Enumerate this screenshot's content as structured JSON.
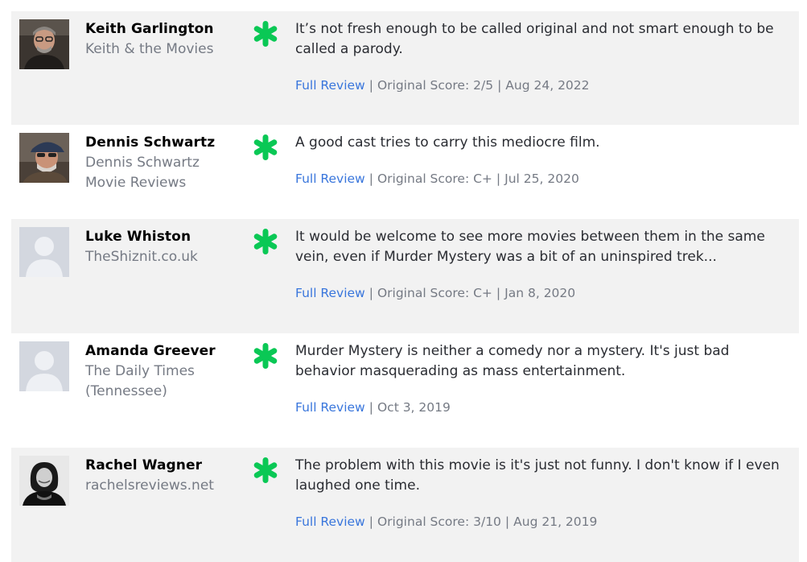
{
  "colors": {
    "row_shaded": "#f2f2f2",
    "row_plain": "#ffffff",
    "critic_name": "#000000",
    "publication": "#757a84",
    "quote_text": "#2a2c32",
    "link": "#3976dc",
    "fresh_splat": "#0ac855"
  },
  "reviews": [
    {
      "avatar": "photo-keith",
      "critic_name": "Keith Garlington",
      "publication_line1": "Keith & the Movies",
      "publication_line2": "",
      "score_icon": "rotten-splat-icon",
      "quote": "It’s not fresh enough to be called original and not smart enough to be called a parody.",
      "full_review_label": "Full Review",
      "original_score": "Original Score: 2/5",
      "date": "Aug 24, 2022"
    },
    {
      "avatar": "photo-dennis",
      "critic_name": "Dennis Schwartz",
      "publication_line1": "Dennis Schwartz",
      "publication_line2": "Movie Reviews",
      "score_icon": "rotten-splat-icon",
      "quote": "A good cast tries to carry this mediocre film.",
      "full_review_label": "Full Review",
      "original_score": "Original Score: C+",
      "date": "Jul 25, 2020"
    },
    {
      "avatar": "placeholder-avatar",
      "critic_name": "Luke Whiston",
      "publication_line1": "TheShiznit.co.uk",
      "publication_line2": "",
      "score_icon": "rotten-splat-icon",
      "quote": "It would be welcome to see more movies between them in the same vein, even if Murder Mystery was a bit of an uninspired trek...",
      "full_review_label": "Full Review",
      "original_score": "Original Score: C+",
      "date": "Jan 8, 2020"
    },
    {
      "avatar": "placeholder-avatar",
      "critic_name": "Amanda Greever",
      "publication_line1": "The Daily Times",
      "publication_line2": "(Tennessee)",
      "score_icon": "rotten-splat-icon",
      "quote": "Murder Mystery is neither a comedy nor a mystery. It's just bad behavior masquerading as mass entertainment.",
      "full_review_label": "Full Review",
      "original_score": "",
      "date": "Oct 3, 2019"
    },
    {
      "avatar": "photo-rachel",
      "critic_name": "Rachel Wagner",
      "publication_line1": "rachelsreviews.net",
      "publication_line2": "",
      "score_icon": "rotten-splat-icon",
      "quote": "The problem with this movie is it's just not funny. I don't know if I even laughed one time.",
      "full_review_label": "Full Review",
      "original_score": "Original Score: 3/10",
      "date": "Aug 21, 2019"
    }
  ]
}
